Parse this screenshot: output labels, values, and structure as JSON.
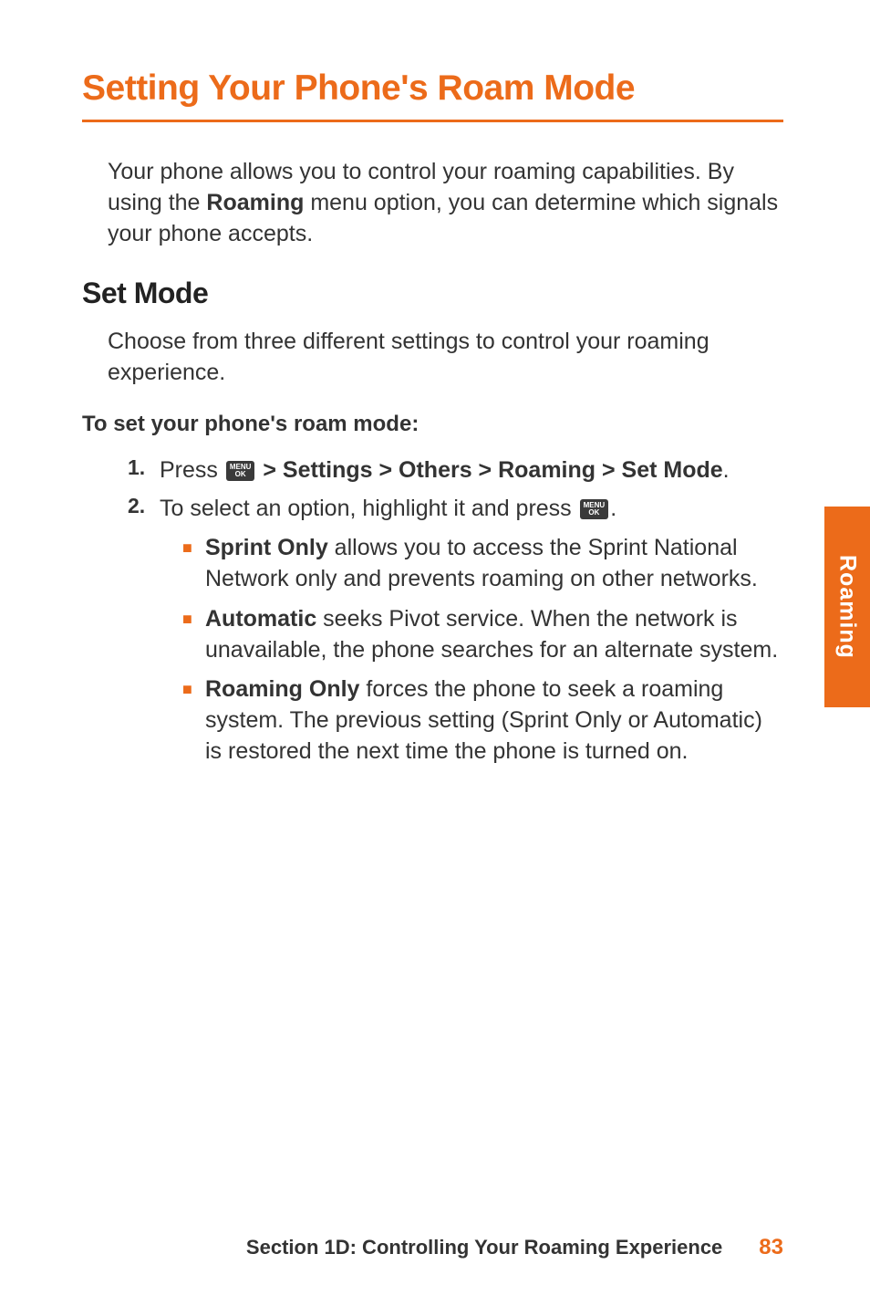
{
  "heading": "Setting Your Phone's Roam Mode",
  "intro_before": "Your phone allows you to control your roaming capabilities. By using the ",
  "intro_bold": "Roaming",
  "intro_after": " menu option, you can determine which signals your phone accepts.",
  "subheading": "Set Mode",
  "body": "Choose from three different settings to control your roaming experience.",
  "instruction_label": "To set your phone's roam mode:",
  "steps": {
    "s1": {
      "num": "1.",
      "before": "Press ",
      "path": " > Settings > Others > Roaming > Set Mode",
      "after": "."
    },
    "s2": {
      "num": "2.",
      "before": "To select an option, highlight it and press ",
      "after": "."
    }
  },
  "bullets": {
    "b1": {
      "bold": "Sprint Only",
      "rest": " allows you to access the Sprint National Network only and prevents roaming on other networks."
    },
    "b2": {
      "bold": "Automatic",
      "rest": " seeks Pivot service. When the network is unavailable, the phone searches for an alternate system."
    },
    "b3": {
      "bold": "Roaming Only",
      "rest": " forces the phone to seek a roaming system. The previous setting (Sprint Only or Automatic) is restored the next time the phone is turned on."
    }
  },
  "icon_label_top": "MENU",
  "icon_label_bottom": "OK",
  "side_tab": "Roaming",
  "footer_section": "Section 1D: Controlling Your Roaming Experience",
  "page_number": "83"
}
